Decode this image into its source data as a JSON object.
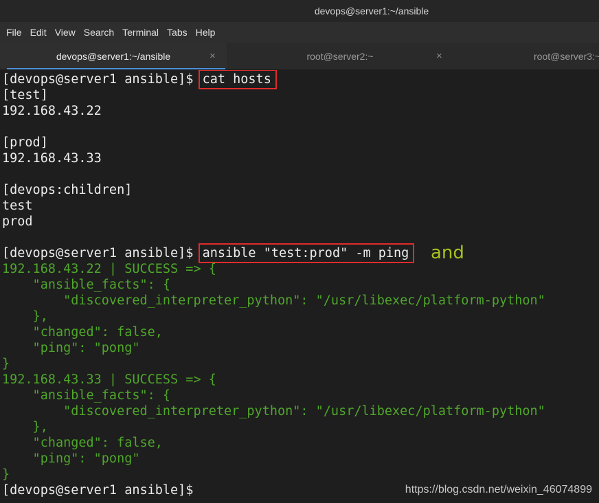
{
  "window": {
    "title": "devops@server1:~/ansible"
  },
  "menu": {
    "items": [
      "File",
      "Edit",
      "View",
      "Search",
      "Terminal",
      "Tabs",
      "Help"
    ]
  },
  "tabs": [
    {
      "label": "devops@server1:~/ansible",
      "close": "×",
      "active": true
    },
    {
      "label": "root@server2:~",
      "close": "×",
      "active": false
    },
    {
      "label": "root@server3:~",
      "close": "",
      "active": false
    }
  ],
  "terminal": {
    "prompt": "[devops@server1 ansible]$ ",
    "command1": "cat hosts",
    "hosts_lines": [
      "[test]",
      "192.168.43.22",
      "",
      "[prod]",
      "192.168.43.33",
      "",
      "[devops:children]",
      "test",
      "prod",
      ""
    ],
    "command2": "ansible \"test:prod\" -m ping",
    "output_lines": [
      "192.168.43.22 | SUCCESS => {",
      "    \"ansible_facts\": {",
      "        \"discovered_interpreter_python\": \"/usr/libexec/platform-python\"",
      "    },",
      "    \"changed\": false,",
      "    \"ping\": \"pong\"",
      "}",
      "192.168.43.33 | SUCCESS => {",
      "    \"ansible_facts\": {",
      "        \"discovered_interpreter_python\": \"/usr/libexec/platform-python\"",
      "    },",
      "    \"changed\": false,",
      "    \"ping\": \"pong\"",
      "}"
    ],
    "final_prompt": "[devops@server1 ansible]$"
  },
  "annotation": "and",
  "watermark": "https://blog.csdn.net/weixin_46074899",
  "colors": {
    "highlight_box": "#e02b2b",
    "output_green": "#4fa62a",
    "annotation": "#a8c21f",
    "tab_indicator": "#4a90d9"
  }
}
